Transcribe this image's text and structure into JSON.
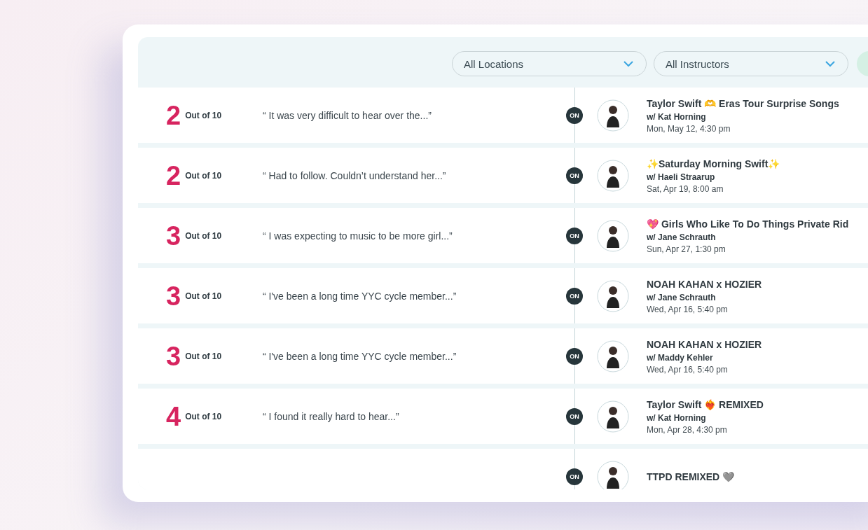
{
  "filters": [
    {
      "label": "All Locations"
    },
    {
      "label": "All Instructors"
    }
  ],
  "reviews": [
    {
      "score": "2",
      "out_of": "Out of 10",
      "quote": "“ It was very difficult to hear over the...”",
      "badge": "ON",
      "title": "Taylor Swift 🫶 Eras Tour Surprise Songs",
      "instructor": "w/ Kat Horning",
      "date": "Mon, May 12, 4:30 pm"
    },
    {
      "score": "2",
      "out_of": "Out of 10",
      "quote": "“ Had to follow. Couldn’t understand her...”",
      "badge": "ON",
      "title": "✨Saturday Morning Swift✨",
      "instructor": "w/ Haeli Straarup",
      "date": "Sat, Apr 19, 8:00 am"
    },
    {
      "score": "3",
      "out_of": "Out of 10",
      "quote": "“ I was expecting to music to be more girl...”",
      "badge": "ON",
      "title": "💖 Girls Who Like To Do Things Private Rid",
      "instructor": "w/ Jane Schrauth",
      "date": "Sun, Apr 27, 1:30 pm"
    },
    {
      "score": "3",
      "out_of": "Out of 10",
      "quote": "“ I've been a long time YYC cycle member...”",
      "badge": "ON",
      "title": "NOAH KAHAN x HOZIER",
      "instructor": "w/ Jane Schrauth",
      "date": "Wed, Apr 16, 5:40 pm"
    },
    {
      "score": "3",
      "out_of": "Out of 10",
      "quote": "“ I've been a long time YYC cycle member...”",
      "badge": "ON",
      "title": "NOAH KAHAN x HOZIER",
      "instructor": "w/ Maddy Kehler",
      "date": "Wed, Apr 16, 5:40 pm"
    },
    {
      "score": "4",
      "out_of": "Out of 10",
      "quote": "“ I found it really hard to hear...”",
      "badge": "ON",
      "title": "Taylor Swift ❤️‍🔥 REMIXED",
      "instructor": "w/ Kat Horning",
      "date": "Mon, Apr 28, 4:30 pm"
    },
    {
      "badge": "ON",
      "title": "TTPD REMIXED 🩶"
    }
  ]
}
